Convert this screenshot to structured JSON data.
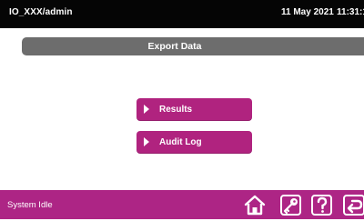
{
  "topbar": {
    "user": "IO_XXX/admin",
    "date": "11 May 2021",
    "time": "11:31:1"
  },
  "header": {
    "title": "Export Data"
  },
  "buttons": {
    "results": "Results",
    "audit_log": "Audit Log"
  },
  "bottombar": {
    "status": "System Idle",
    "icons": [
      "home-icon",
      "key-icon",
      "help-icon",
      "back-icon"
    ]
  },
  "colors": {
    "topbar": "#050505",
    "header": "#6d6d6d",
    "accent": "#b0237f",
    "bottombar": "#ad2585"
  }
}
